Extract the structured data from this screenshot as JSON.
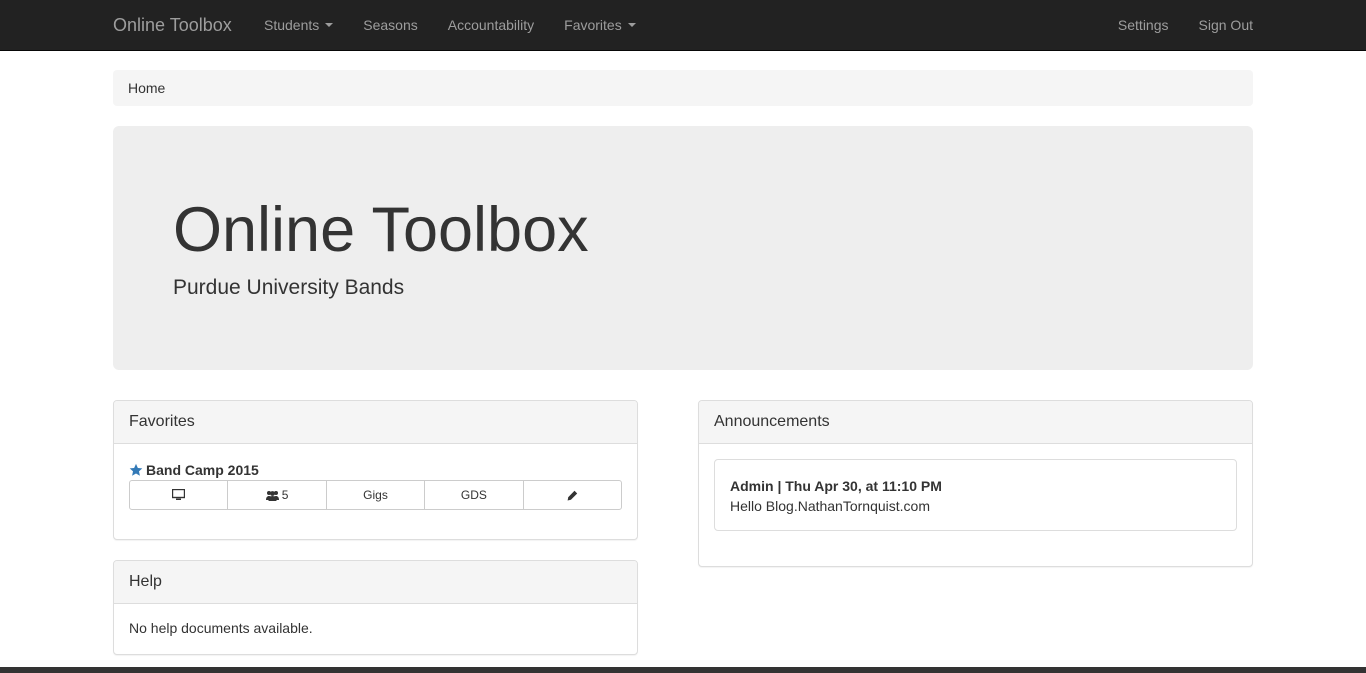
{
  "navbar": {
    "brand": "Online Toolbox",
    "left_items": [
      {
        "label": "Students",
        "dropdown": true
      },
      {
        "label": "Seasons",
        "dropdown": false
      },
      {
        "label": "Accountability",
        "dropdown": false
      },
      {
        "label": "Favorites",
        "dropdown": true
      }
    ],
    "right_items": [
      {
        "label": "Settings"
      },
      {
        "label": "Sign Out"
      }
    ]
  },
  "breadcrumb": {
    "items": [
      "Home"
    ]
  },
  "jumbotron": {
    "title": "Online Toolbox",
    "subtitle": "Purdue University Bands"
  },
  "favorites": {
    "heading": "Favorites",
    "items": [
      {
        "title": "Band Camp 2015",
        "star_icon": "star-icon",
        "buttons": {
          "monitor_icon": "monitor-icon",
          "users_icon": "users-icon",
          "users_count": "5",
          "gigs": "Gigs",
          "gds": "GDS",
          "edit_icon": "pencil-icon"
        }
      }
    ]
  },
  "help": {
    "heading": "Help",
    "text": "No help documents available."
  },
  "announcements": {
    "heading": "Announcements",
    "items": [
      {
        "header": "Admin | Thu Apr 30, at 11:10 PM",
        "body": "Hello Blog.NathanTornquist.com"
      }
    ]
  },
  "colors": {
    "navbar_bg": "#222222",
    "navbar_text": "#9d9d9d",
    "jumbotron_bg": "#eeeeee",
    "panel_heading_bg": "#f5f5f5",
    "star": "#337ab7"
  }
}
